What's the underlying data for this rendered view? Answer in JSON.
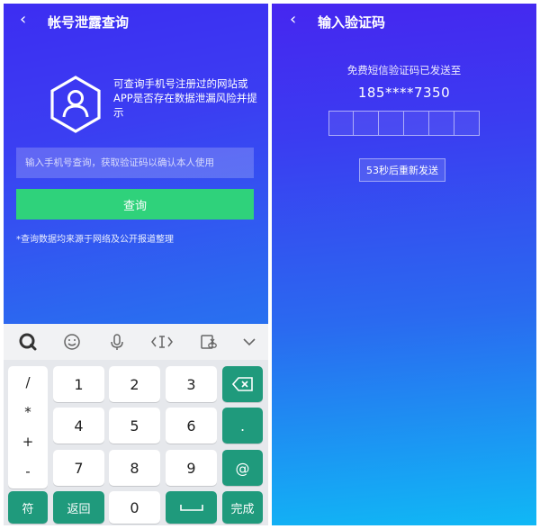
{
  "left_screen": {
    "title": "帐号泄露查询",
    "info_text": "可查询手机号注册过的网站或APP是否存在数据泄漏风险并提示",
    "phone_input_placeholder": "输入手机号查询，获取验证码以确认本人使用",
    "query_button": "查询",
    "note": "*查询数据均来源于网络及公开报道整理",
    "icons": {
      "back": "back-chevron-icon",
      "badge": "user-hexagon-icon"
    },
    "colors": {
      "accent_green": "#2fd27b",
      "gradient_top": "#3d2df2",
      "gradient_bottom": "#1b95f2"
    }
  },
  "keyboard": {
    "toolbar_icons": [
      "search-q-icon",
      "emoji-icon",
      "microphone-icon",
      "cursor-move-icon",
      "clipboard-scissors-icon",
      "collapse-chevron-icon"
    ],
    "symbols": [
      "/",
      "*",
      "+",
      "-"
    ],
    "digits": [
      "1",
      "2",
      "3",
      "4",
      "5",
      "6",
      "7",
      "8",
      "9",
      "0"
    ],
    "right_keys": [
      "⌫",
      ".",
      "@"
    ],
    "bottom_left": "符",
    "back_key": "返回",
    "done_key": "完成",
    "key_green": "#1f9a7c"
  },
  "right_screen": {
    "title": "输入验证码",
    "sent_text": "免费短信验证码已发送至",
    "phone_number": "185****7350",
    "code_length": 6,
    "resend_button": "53秒后重新发送"
  }
}
